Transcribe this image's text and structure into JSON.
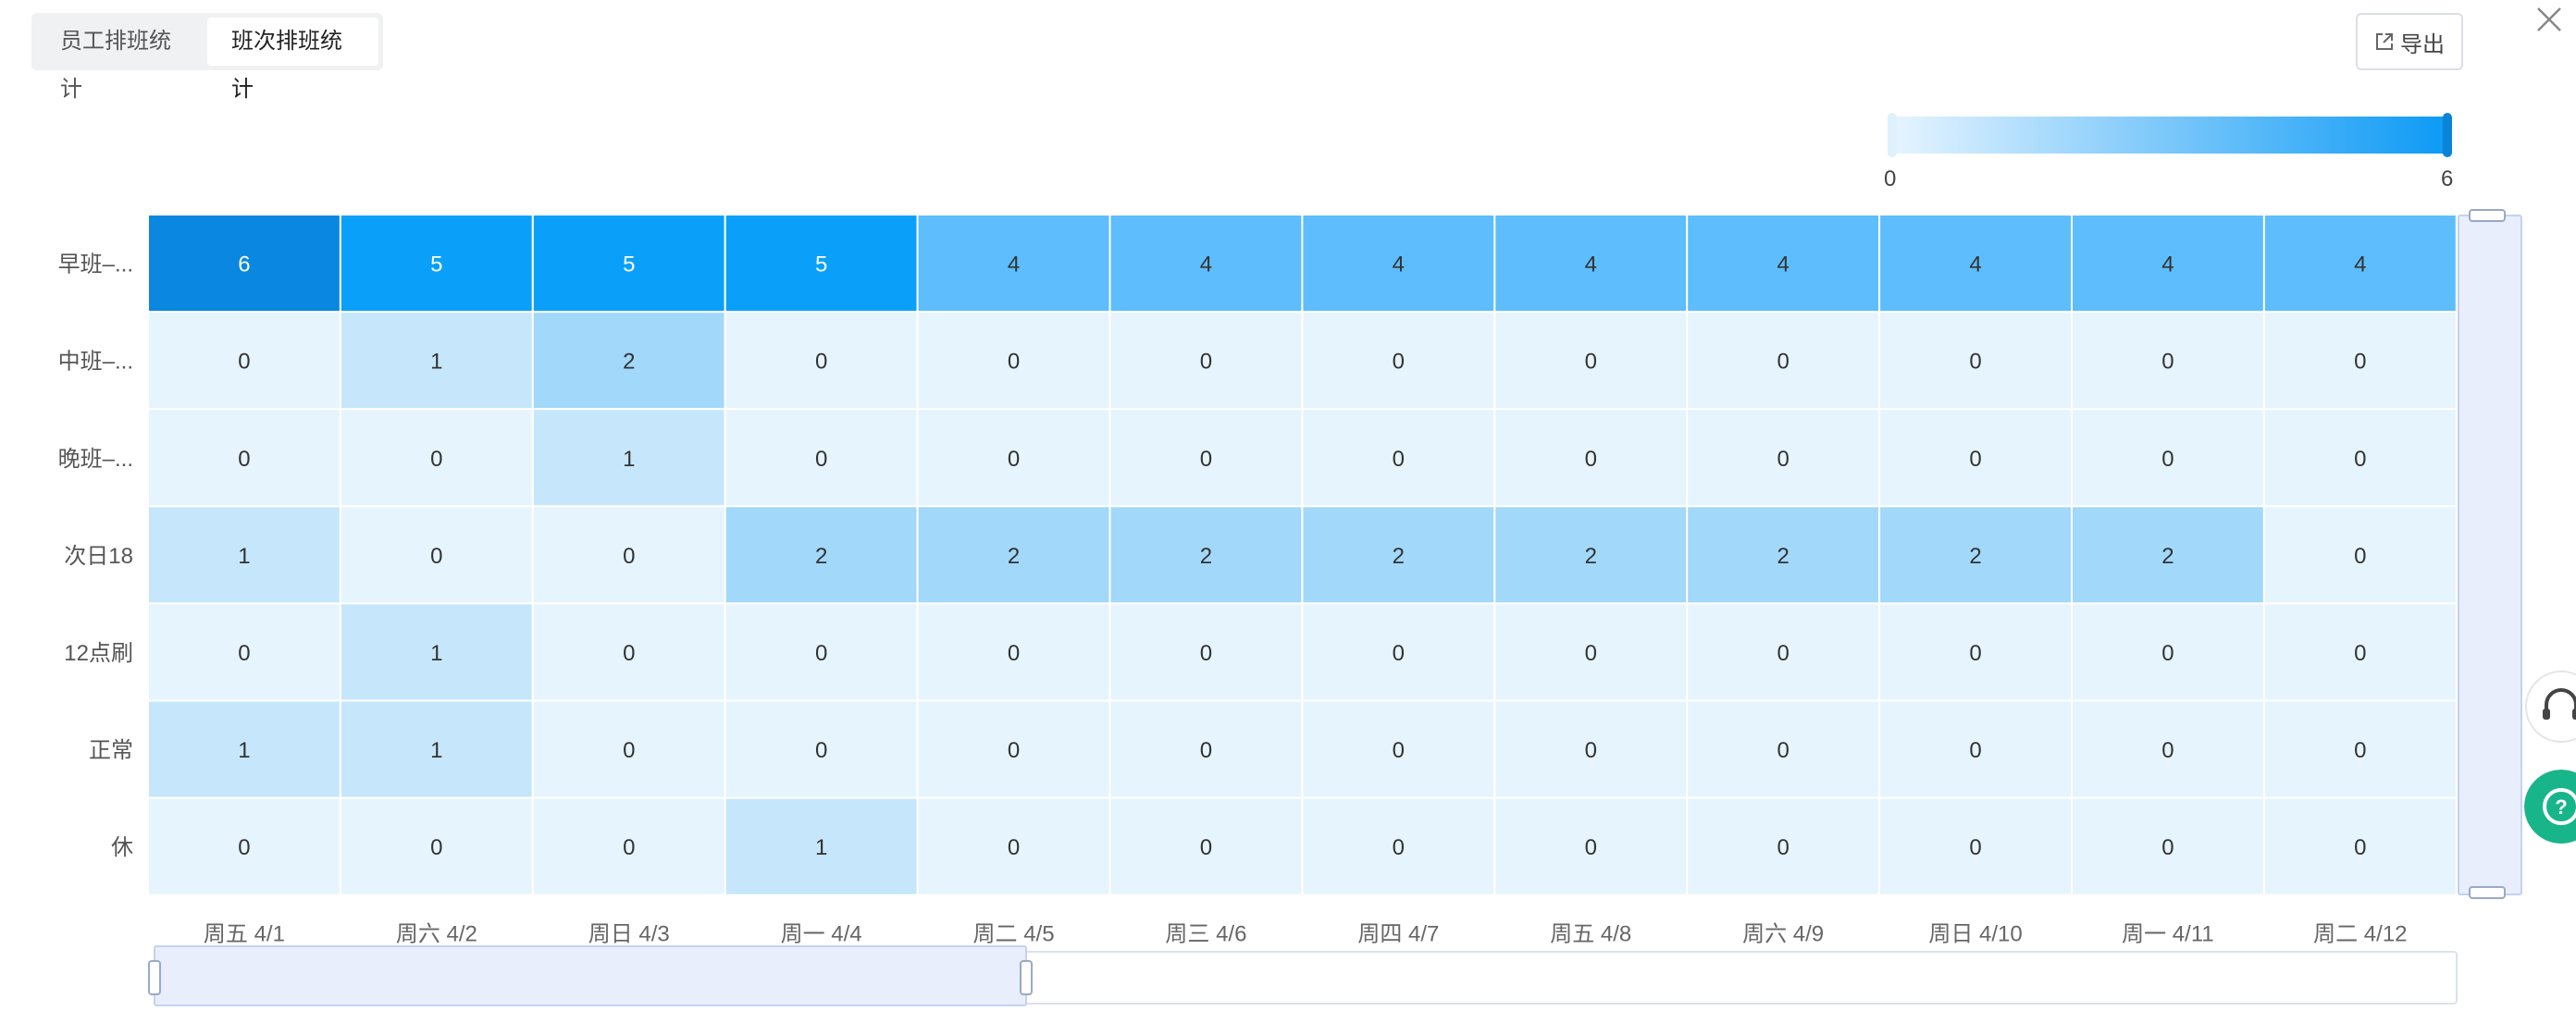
{
  "tabs": [
    {
      "label": "员工排班统计",
      "active": false
    },
    {
      "label": "班次排班统计",
      "active": true
    }
  ],
  "toolbar": {
    "export_label": "导出"
  },
  "visual_map": {
    "min_label": "0",
    "max_label": "6",
    "range": [
      0,
      6
    ],
    "color_low": "#e8f5ff",
    "color_high": "#0b99f5"
  },
  "chart_data": {
    "type": "heatmap",
    "title": "",
    "xlabel": "",
    "ylabel": "",
    "x": [
      "周五 4/1",
      "周六 4/2",
      "周日 4/3",
      "周一 4/4",
      "周二 4/5",
      "周三 4/6",
      "周四 4/7",
      "周五 4/8",
      "周六 4/9",
      "周日 4/10",
      "周一 4/11",
      "周二 4/12"
    ],
    "y": [
      "早班–...",
      "中班–...",
      "晚班–...",
      "次日18",
      "12点刷",
      "正常",
      "休"
    ],
    "values": [
      [
        6,
        5,
        5,
        5,
        4,
        4,
        4,
        4,
        4,
        4,
        4,
        4
      ],
      [
        0,
        1,
        2,
        0,
        0,
        0,
        0,
        0,
        0,
        0,
        0,
        0
      ],
      [
        0,
        0,
        1,
        0,
        0,
        0,
        0,
        0,
        0,
        0,
        0,
        0
      ],
      [
        1,
        0,
        0,
        2,
        2,
        2,
        2,
        2,
        2,
        2,
        2,
        0
      ],
      [
        0,
        1,
        0,
        0,
        0,
        0,
        0,
        0,
        0,
        0,
        0,
        0
      ],
      [
        1,
        1,
        0,
        0,
        0,
        0,
        0,
        0,
        0,
        0,
        0,
        0
      ],
      [
        0,
        0,
        0,
        1,
        0,
        0,
        0,
        0,
        0,
        0,
        0,
        0
      ]
    ],
    "value_range": [
      0,
      6
    ],
    "colors": [
      "#e6f4fd",
      "#c6e7fb",
      "#a2d8fa",
      "#80caf9",
      "#5dbdfd",
      "#0aa0f9",
      "#0a87e0"
    ],
    "grid": true,
    "legend": "top-right"
  }
}
